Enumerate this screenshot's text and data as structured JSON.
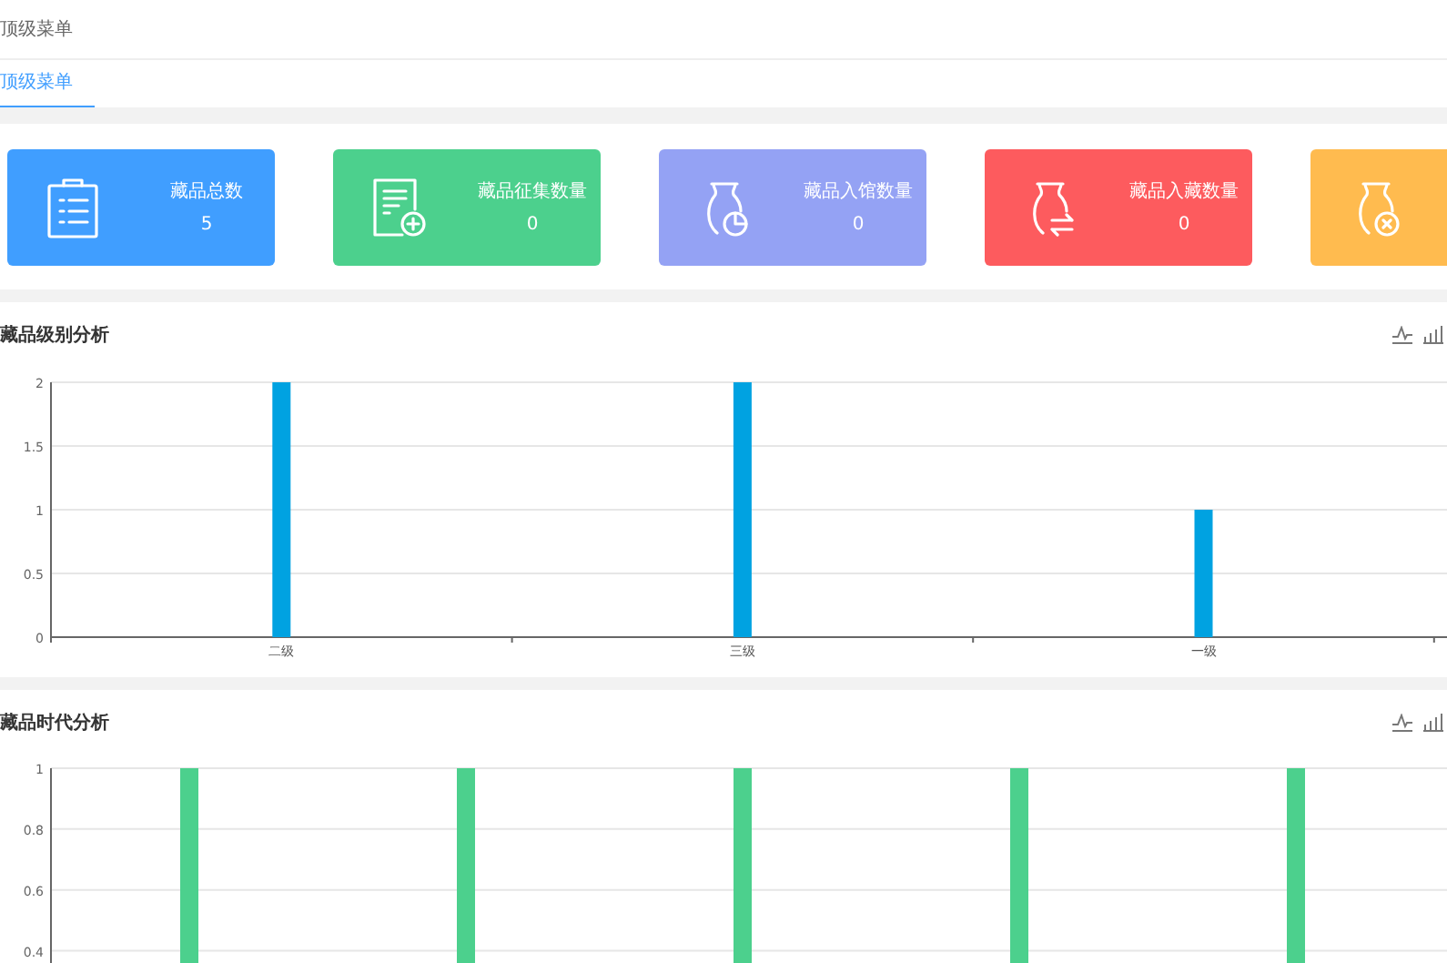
{
  "header": {
    "breadcrumb": "顶级菜单"
  },
  "tabs": [
    {
      "label": "顶级菜单",
      "selected": true
    }
  ],
  "stat_cards": [
    {
      "kind": "clipboard",
      "label": "藏品总数",
      "value": "5",
      "color": "#409eff"
    },
    {
      "kind": "document",
      "label": "藏品征集数量",
      "value": "0",
      "color": "#4cd08d"
    },
    {
      "kind": "vase-pie",
      "label": "藏品入馆数量",
      "value": "0",
      "color": "#94a2f4"
    },
    {
      "kind": "vase-exchange",
      "label": "藏品入藏数量",
      "value": "0",
      "color": "#fd5b5e"
    },
    {
      "kind": "vase-cancel",
      "color": "#ffbb4f"
    }
  ],
  "panels": [
    {
      "title": "藏品级别分析",
      "chart_data": {
        "type": "bar",
        "categories": [
          "二级",
          "三级",
          "一级"
        ],
        "series": [
          {
            "color": "#00a2e1",
            "values": [
              2,
              2,
              1
            ]
          }
        ],
        "grid": true,
        "ylim": [
          0,
          2
        ],
        "yticks": [
          0,
          0.5,
          1,
          1.5,
          2
        ]
      }
    },
    {
      "title": "藏品时代分析",
      "chart_data": {
        "type": "bar",
        "series": [
          {
            "color": "#4cd08d",
            "values": [
              1,
              1,
              1,
              1,
              1
            ]
          }
        ],
        "grid": true,
        "ylim": [
          0.33,
          1
        ],
        "yticks": [
          0.4,
          0.6,
          0.8,
          1
        ]
      }
    }
  ]
}
